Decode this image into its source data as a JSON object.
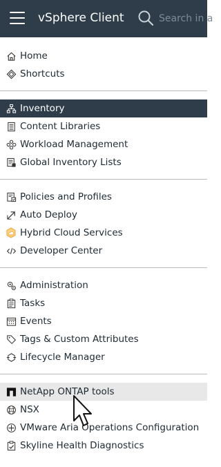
{
  "header": {
    "title": "vSphere Client",
    "search_placeholder": "Search in a"
  },
  "groups": [
    {
      "items": [
        {
          "label": "Home",
          "icon": "home-icon"
        },
        {
          "label": "Shortcuts",
          "icon": "shortcuts-icon"
        }
      ]
    },
    {
      "items": [
        {
          "label": "Inventory",
          "icon": "inventory-icon",
          "state": "selected"
        },
        {
          "label": "Content Libraries",
          "icon": "content-libraries-icon"
        },
        {
          "label": "Workload Management",
          "icon": "workload-management-icon"
        },
        {
          "label": "Global Inventory Lists",
          "icon": "global-inventory-icon"
        }
      ]
    },
    {
      "items": [
        {
          "label": "Policies and Profiles",
          "icon": "policies-icon"
        },
        {
          "label": "Auto Deploy",
          "icon": "auto-deploy-icon"
        },
        {
          "label": "Hybrid Cloud Services",
          "icon": "hybrid-cloud-icon"
        },
        {
          "label": "Developer Center",
          "icon": "developer-center-icon"
        }
      ]
    },
    {
      "items": [
        {
          "label": "Administration",
          "icon": "administration-icon"
        },
        {
          "label": "Tasks",
          "icon": "tasks-icon"
        },
        {
          "label": "Events",
          "icon": "events-icon"
        },
        {
          "label": "Tags & Custom Attributes",
          "icon": "tags-icon"
        },
        {
          "label": "Lifecycle Manager",
          "icon": "lifecycle-manager-icon"
        }
      ]
    },
    {
      "items": [
        {
          "label": "NetApp ONTAP tools",
          "icon": "netapp-icon",
          "state": "hovered"
        },
        {
          "label": "NSX",
          "icon": "nsx-icon"
        },
        {
          "label": "VMware Aria Operations Configuration",
          "icon": "aria-operations-icon"
        },
        {
          "label": "Skyline Health Diagnostics",
          "icon": "skyline-health-icon"
        }
      ]
    }
  ],
  "colors": {
    "header_bg": "#2f3d4a",
    "selected_bg": "#2f3d4a",
    "hover_bg": "#e8e8e8",
    "divider": "#b7bcc1",
    "hybrid_cloud_icon": "#f2a93b"
  }
}
